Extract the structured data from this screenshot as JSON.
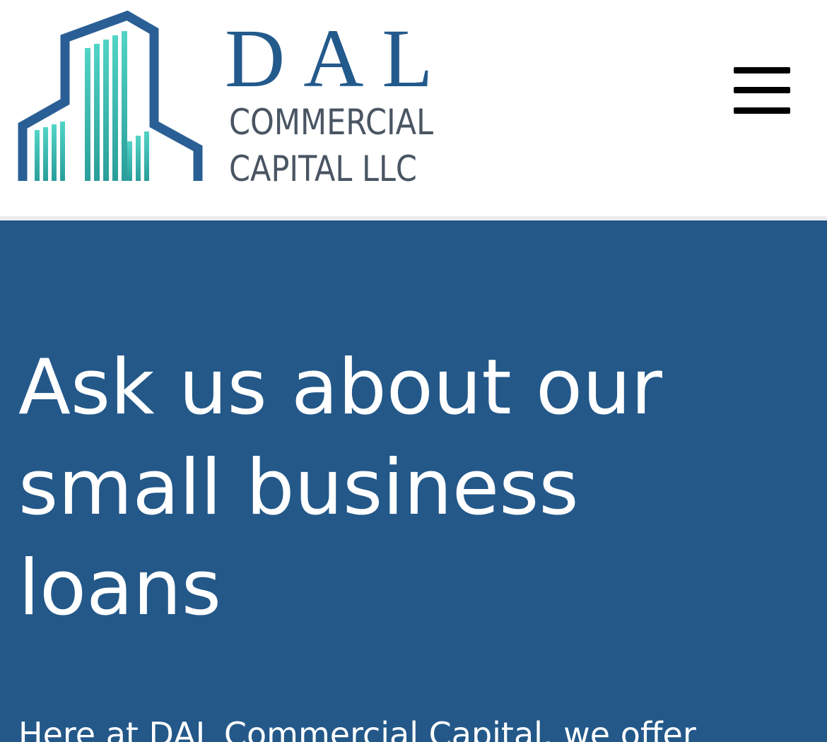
{
  "colors": {
    "brand_blue": "#235a8c",
    "hero_background": "#235889",
    "logo_teal": "#3cbfb3",
    "logo_text_gray": "#4a5563"
  },
  "header": {
    "logo": {
      "main_text": "DAL",
      "line1": "COMMERCIAL",
      "line2": "CAPITAL LLC",
      "icon": "building-icon"
    },
    "menu_icon": "hamburger-menu-icon"
  },
  "hero": {
    "title": "Ask us about our small business loans",
    "body": "Here at DAL Commercial Capital, we offer"
  }
}
